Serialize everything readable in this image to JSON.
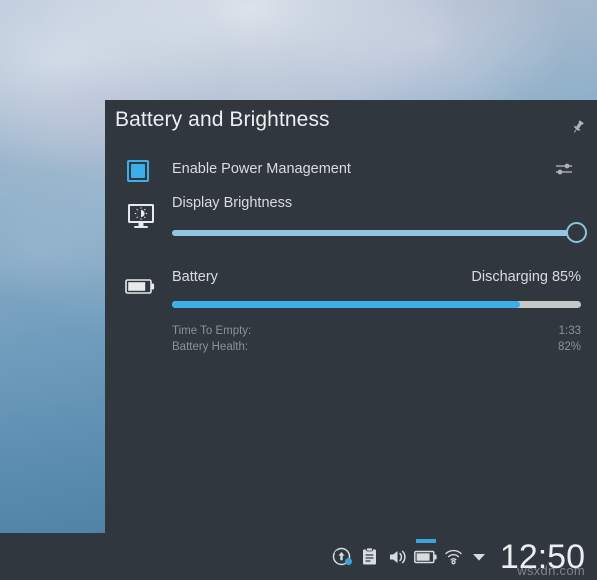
{
  "popup": {
    "title": "Battery and Brightness",
    "pin_icon": "pin-icon",
    "power": {
      "label": "Enable Power Management",
      "checked": true,
      "checkbox_icon": "checkbox-checked-icon",
      "config_icon": "configure-sliders-icon"
    },
    "brightness": {
      "label": "Display Brightness",
      "icon": "display-brightness-icon",
      "value": 99,
      "min": 0,
      "max": 100
    },
    "battery": {
      "label": "Battery",
      "icon": "battery-icon",
      "state": "Discharging",
      "percent_label": "85%",
      "percent": 85,
      "details": [
        {
          "label": "Time To Empty:",
          "value": "1:33"
        },
        {
          "label": "Battery Health:",
          "value": "82%"
        }
      ]
    }
  },
  "taskbar": {
    "tray": [
      {
        "name": "software-updates-icon",
        "label": "Software Updates"
      },
      {
        "name": "clipboard-icon",
        "label": "Clipboard"
      },
      {
        "name": "volume-icon",
        "label": "Volume"
      },
      {
        "name": "battery-tray-icon",
        "label": "Battery and Brightness"
      },
      {
        "name": "network-wifi-icon",
        "label": "Networks"
      },
      {
        "name": "show-hidden-icon",
        "label": "Show hidden icons"
      }
    ],
    "clock": "12:50"
  },
  "watermark": "wsxdn.com",
  "colors": {
    "accent": "#3daee9",
    "panel_bg": "#31373e",
    "text": "#d8dcdf",
    "muted_text": "#8b9298",
    "progress_remaining": "#c6c9ca",
    "slider_fill": "#93c4e0"
  }
}
